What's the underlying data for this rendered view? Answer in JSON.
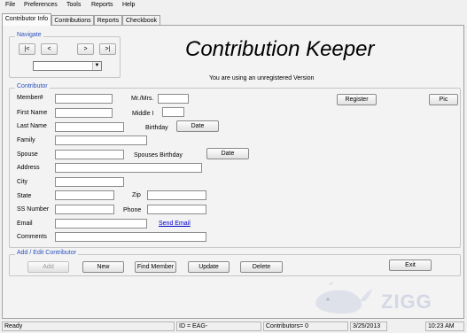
{
  "menu": [
    "File",
    "Preferences",
    "Tools",
    "Reports",
    "Help"
  ],
  "tabs": [
    "Contributor Info",
    "Contributions",
    "Reports",
    "Checkbook"
  ],
  "navigate": {
    "legend": "Navigate",
    "first": "|<",
    "prev": "<",
    "next": ">",
    "last": ">|",
    "select_value": ""
  },
  "header": {
    "title": "Contribution Keeper",
    "subtitle": "You are using an unregistered Version"
  },
  "contributor": {
    "legend": "Contributor",
    "labels": {
      "member": "Member#",
      "mrmrs": "Mr./Mrs.",
      "first_name": "First Name",
      "middle": "Middle I",
      "last_name": "Last Name",
      "birthday": "Birthday",
      "family": "Family",
      "spouse": "Spouse",
      "spouses_birthday": "Spouses Birthday",
      "address": "Address",
      "city": "City",
      "state": "State",
      "zip": "Zip",
      "ss_number": "SS Number",
      "phone": "Phone",
      "email": "Email",
      "comments": "Comments"
    },
    "values": {
      "member": "",
      "mrmrs": "",
      "first_name": "",
      "middle": "",
      "last_name": "",
      "family": "",
      "spouse": "",
      "address": "",
      "city": "",
      "state": "",
      "zip": "",
      "ss_number": "",
      "phone": "",
      "email": "",
      "comments": ""
    },
    "date_button": "Date",
    "spouse_date_button": "Date",
    "send_email": "Send Email",
    "register": "Register",
    "pic": "Pic"
  },
  "edit": {
    "legend": "Add / Edit Contributor",
    "add": "Add",
    "new": "New",
    "find": "Find Member",
    "update": "Update",
    "delete": "Delete",
    "exit": "Exit"
  },
  "status": {
    "state": "Ready",
    "id": "ID = EAG-",
    "contributors": "Contributors= 0",
    "date": "3/25/2013",
    "time": "10:23 AM"
  },
  "watermark": "ZIGG",
  "colors": {
    "legend": "#2a52be",
    "link": "#0000cc"
  }
}
